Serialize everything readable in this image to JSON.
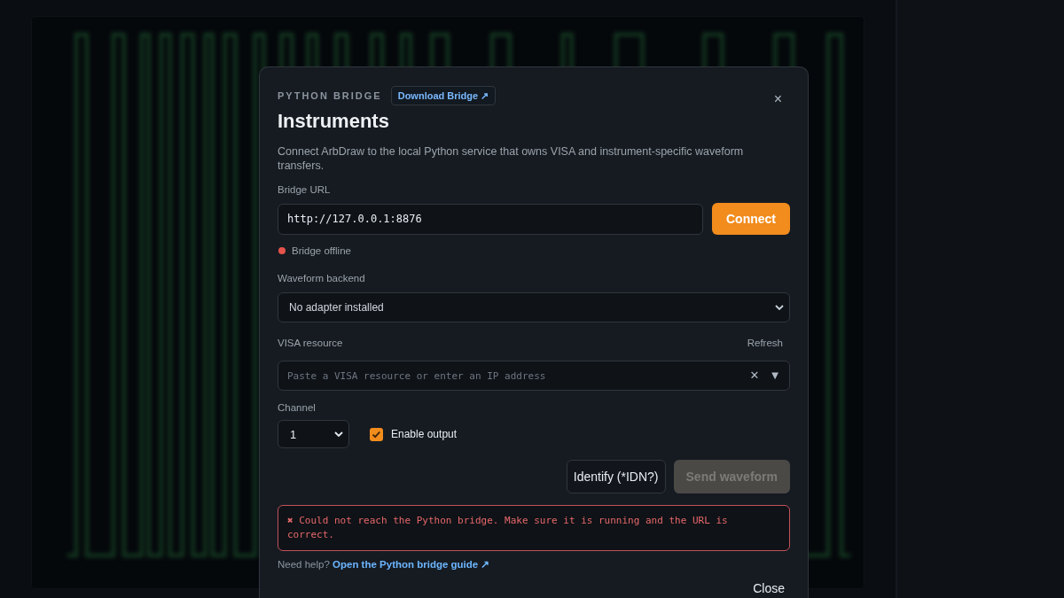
{
  "dialog": {
    "eyebrow": "PYTHON BRIDGE",
    "download_link": "Download Bridge ↗",
    "close": "×",
    "title": "Instruments",
    "description": "Connect ArbDraw to the local Python service that owns VISA and instrument-specific waveform transfers."
  },
  "bridge_url": {
    "label": "Bridge URL",
    "value": "http://127.0.0.1:8876",
    "button": "Connect"
  },
  "status": {
    "online": false,
    "label": "Bridge offline"
  },
  "waveform_backend": {
    "label": "Waveform backend",
    "value": "No adapter installed"
  },
  "visa_resource": {
    "label": "VISA resource",
    "refresh": "Refresh",
    "placeholder": "Paste a VISA resource or enter an IP address",
    "clear": "✕",
    "dropdown": "▼"
  },
  "channel": {
    "label": "Channel",
    "value": "1"
  },
  "enable_output": {
    "label": "Enable output",
    "checked": true
  },
  "actions": [
    {
      "label": "Identify (*IDN?)",
      "kind": "secondary",
      "disabled": false
    },
    {
      "label": "Send waveform",
      "kind": "primary",
      "disabled": true
    }
  ],
  "error": {
    "message": "✖ Could not reach the Python bridge. Make sure it is running and the URL is correct."
  },
  "help": {
    "text": "Need help?",
    "link": "Open the Python bridge guide ↗"
  },
  "footer": {
    "close": "Close"
  }
}
